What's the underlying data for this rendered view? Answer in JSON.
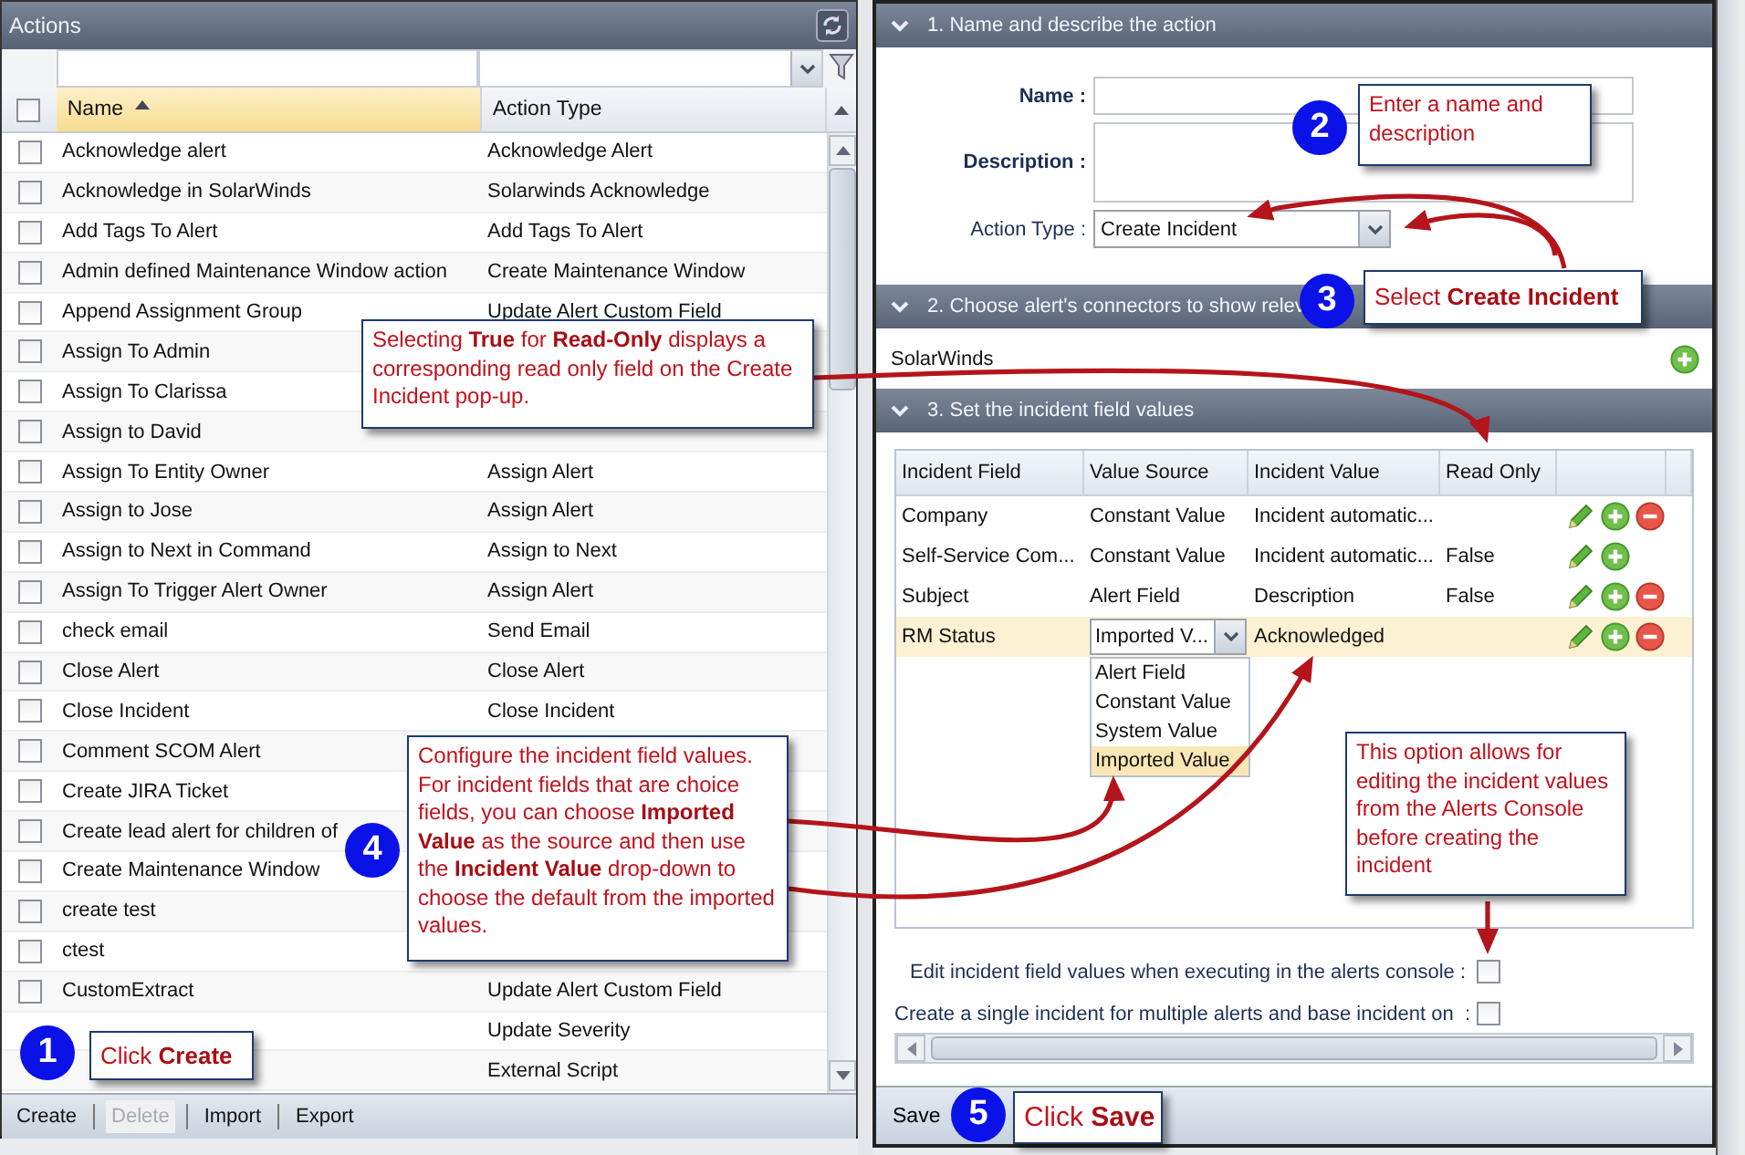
{
  "actions_panel": {
    "title": "Actions",
    "columns": [
      {
        "label": "Name",
        "sorted": true
      },
      {
        "label": "Action Type",
        "sorted": false
      }
    ],
    "rows": [
      {
        "name": "Acknowledge alert",
        "type": "Acknowledge Alert",
        "checked": false
      },
      {
        "name": "Acknowledge in SolarWinds",
        "type": "Solarwinds Acknowledge",
        "checked": false
      },
      {
        "name": "Add Tags To Alert",
        "type": "Add Tags To Alert",
        "checked": false
      },
      {
        "name": "Admin defined Maintenance Window action",
        "type": "Create Maintenance Window",
        "checked": false
      },
      {
        "name": "Append Assignment Group",
        "type": "Update Alert Custom Field",
        "checked": false
      },
      {
        "name": "Assign To Admin",
        "checked": false
      },
      {
        "name": "Assign To Clarissa",
        "checked": false
      },
      {
        "name": "Assign to David",
        "checked": false
      },
      {
        "name": "Assign To Entity Owner",
        "type": "Assign Alert",
        "checked": false
      },
      {
        "name": "Assign to Jose",
        "type": "Assign Alert",
        "checked": false
      },
      {
        "name": "Assign to Next in Command",
        "type": "Assign to Next",
        "checked": false
      },
      {
        "name": "Assign To Trigger Alert Owner",
        "type": "Assign Alert",
        "checked": false
      },
      {
        "name": "check email",
        "type": "Send Email",
        "checked": false
      },
      {
        "name": "Close Alert",
        "type": "Close Alert",
        "checked": false
      },
      {
        "name": "Close Incident",
        "type": "Close Incident",
        "checked": false
      },
      {
        "name": "Comment SCOM Alert",
        "checked": false
      },
      {
        "name": "Create JIRA Ticket",
        "checked": false
      },
      {
        "name": "Create lead alert for children of",
        "checked": false
      },
      {
        "name": "Create Maintenance Window",
        "checked": false
      },
      {
        "name": "create test",
        "checked": false
      },
      {
        "name": "ctest",
        "checked": false
      },
      {
        "name": "CustomExtract",
        "type": "Update Alert Custom Field",
        "checked": false
      },
      {
        "type": "Update Severity"
      },
      {
        "type": "External Script"
      }
    ],
    "header_checked": false,
    "toolbar": [
      {
        "label": "Create",
        "disabled": false
      },
      {
        "label": "Delete",
        "disabled": true
      },
      {
        "label": "Import",
        "disabled": false
      },
      {
        "label": "Export",
        "disabled": false
      }
    ]
  },
  "sections": [
    {
      "title": "1. Name and describe the action",
      "expanded": true
    },
    {
      "title": "2. Choose alert's connectors to show relev",
      "expanded": true
    },
    {
      "title": "3. Set the incident field values",
      "expanded": true
    }
  ],
  "form": {
    "name_label": "Name :",
    "description_label": "Description :",
    "action_type_label": "Action Type :",
    "action_type_value": "Create Incident"
  },
  "connectors": [
    {
      "name": "SolarWinds"
    }
  ],
  "incident_grid": {
    "columns": [
      "Incident Field",
      "Value Source",
      "Incident Value",
      "Read Only"
    ],
    "rows": [
      {
        "field": "Company",
        "source": "Constant Value",
        "value": "Incident automatic...",
        "selected": false,
        "removable": true
      },
      {
        "field": "Self-Service Com...",
        "source": "Constant Value",
        "value": "Incident automatic...",
        "read_only": "False",
        "selected": false,
        "removable": false
      },
      {
        "field": "Subject",
        "source": "Alert Field",
        "value": "Description",
        "read_only": "False",
        "selected": false,
        "removable": true
      },
      {
        "field": "RM Status",
        "source_select": {
          "value": "Imported V...",
          "open": true,
          "options": [
            {
              "label": "Alert Field",
              "selected": false
            },
            {
              "label": "Constant Value",
              "selected": false
            },
            {
              "label": "System Value",
              "selected": false
            },
            {
              "label": "Imported Value",
              "selected": true
            }
          ]
        },
        "value": "Acknowledged",
        "selected": true,
        "removable": true
      }
    ]
  },
  "options": [
    {
      "label": "Edit incident field values when executing in the alerts console :",
      "checked": false
    },
    {
      "label": "Create a single incident for multiple alerts and base incident on  :",
      "checked": false
    }
  ],
  "footer": {
    "save": "Save"
  },
  "callouts": [
    {
      "step": "2",
      "text": "Enter a name and description"
    },
    {
      "step": "3",
      "text": "Select **Create Incident**"
    },
    {
      "text": "Selecting **True** for **Read-Only** displays a corresponding read only field on the Create Incident pop-up."
    },
    {
      "step": "4",
      "text": "Configure the incident field values. For incident fields that are choice fields, you can choose **Imported Value** as the source and then use the **Incident Value** drop-down to choose the default from the imported values."
    },
    {
      "text": "This option allows for editing the incident values from the Alerts Console before creating the incident"
    },
    {
      "step": "1",
      "text": "Click **Create**"
    },
    {
      "step": "5",
      "text": "Click **Save**"
    }
  ]
}
